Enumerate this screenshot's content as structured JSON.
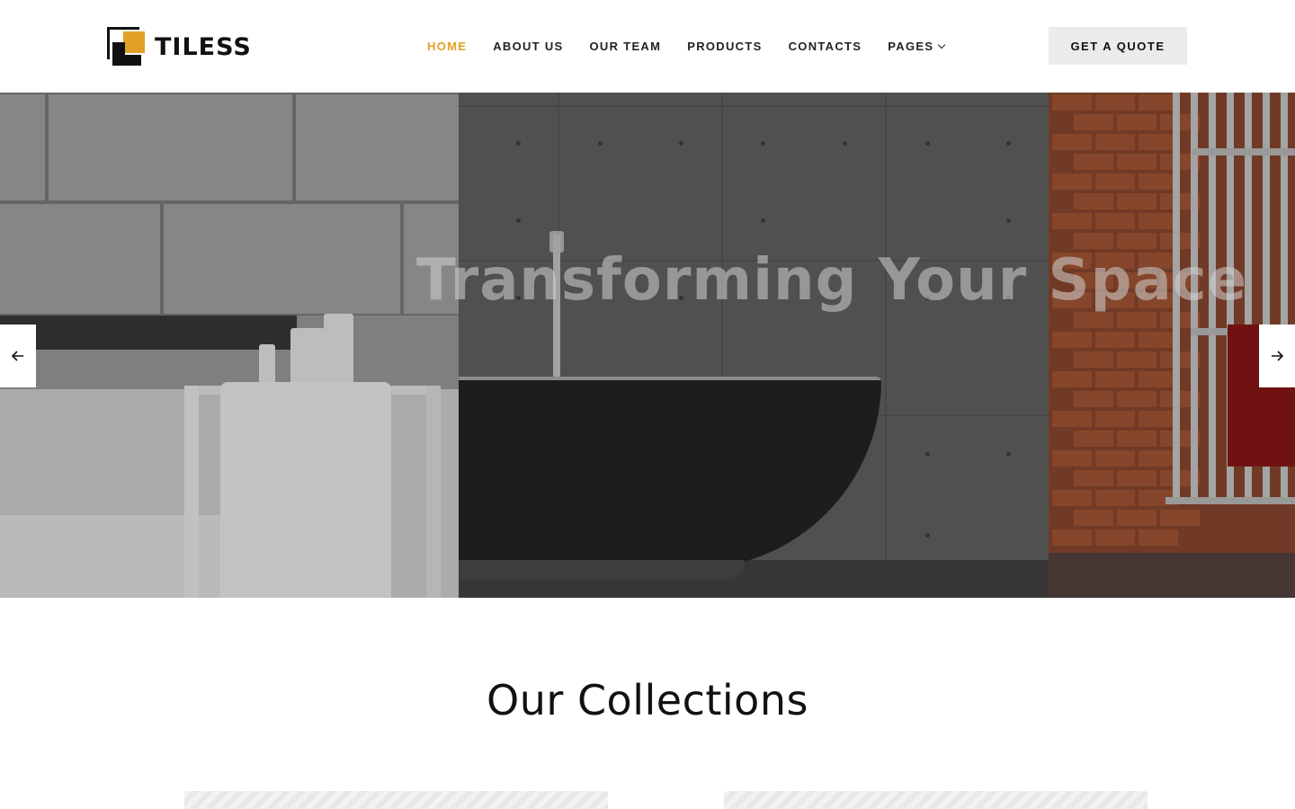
{
  "brand": {
    "name": "TILESS",
    "accent": "#e0a126"
  },
  "nav": {
    "items": [
      {
        "label": "HOME",
        "active": true
      },
      {
        "label": "ABOUT US",
        "active": false
      },
      {
        "label": "OUR TEAM",
        "active": false
      },
      {
        "label": "PRODUCTS",
        "active": false
      },
      {
        "label": "CONTACTS",
        "active": false
      },
      {
        "label": "PAGES",
        "active": false
      }
    ],
    "cta_label": "GET A QUOTE"
  },
  "hero": {
    "title": "Transforming Your Space",
    "prev_icon": "arrow-left-icon",
    "next_icon": "arrow-right-icon"
  },
  "collections": {
    "title": "Our Collections"
  }
}
